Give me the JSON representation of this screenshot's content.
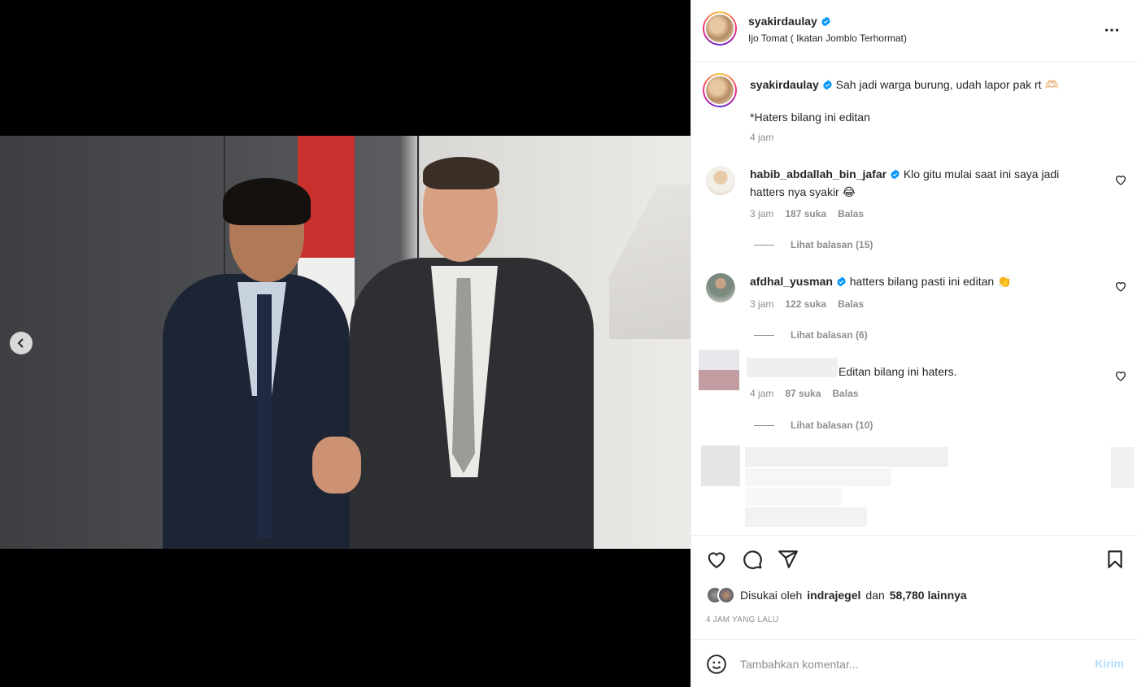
{
  "post": {
    "username": "syakirdaulay",
    "location": "Ijo Tomat ( Ikatan Jomblo Terhormat)",
    "caption_text": "Sah jadi warga burung, udah lapor pak rt 🫶🏻",
    "caption_line2": "*Haters bilang ini editan",
    "caption_time": "4 jam"
  },
  "comments": [
    {
      "username": "habib_abdallah_bin_jafar",
      "text": "Klo gitu mulai saat ini saya jadi hatters nya syakir 😂",
      "time": "3 jam",
      "likes": "187 suka",
      "reply": "Balas",
      "view_replies": "Lihat balasan (15)"
    },
    {
      "username": "afdhal_yusman",
      "text": "hatters bilang pasti ini editan 👏",
      "time": "3 jam",
      "likes": "122 suka",
      "reply": "Balas",
      "view_replies": "Lihat balasan (6)"
    },
    {
      "username": "",
      "text": "Editan bilang ini haters.",
      "time": "4 jam",
      "likes": "87 suka",
      "reply": "Balas",
      "view_replies": "Lihat balasan (10)"
    }
  ],
  "engagement": {
    "liked_by_prefix": "Disukai oleh",
    "liked_by_user": "indrajegel",
    "liked_by_and": "dan",
    "liked_by_count": "58,780 lainnya",
    "posted_ago": "4 JAM YANG LALU"
  },
  "add_comment": {
    "placeholder": "Tambahkan komentar...",
    "post_label": "Kirim"
  },
  "icons": [
    "chevron-left-icon",
    "more-icon",
    "verified-icon",
    "heart-icon",
    "comment-icon",
    "share-icon",
    "bookmark-icon",
    "emoji-icon"
  ],
  "colors": {
    "verified": "#0095f6",
    "post_disabled": "#b2dffc",
    "muted": "#8e8e8e"
  }
}
